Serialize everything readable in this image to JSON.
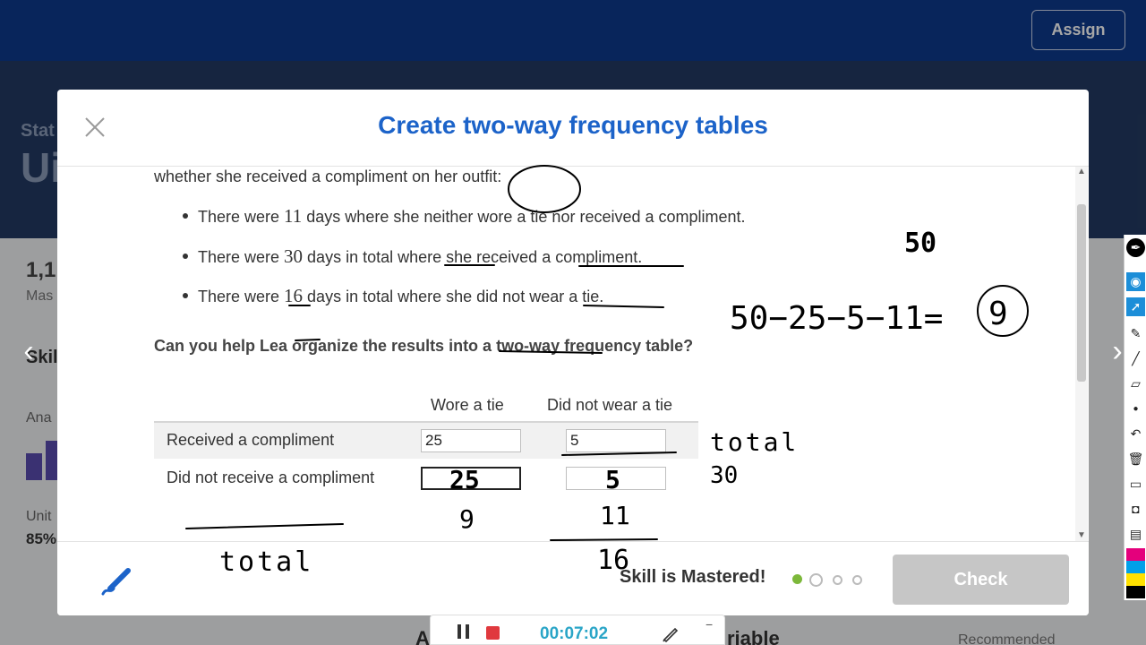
{
  "header": {
    "assign_label": "Assign"
  },
  "background": {
    "hero_sub": "Stat",
    "hero_title": "Ui",
    "stat_value": "1,1",
    "stat_label": "Mas",
    "skill_label": "Skil",
    "ana_label": "Ana",
    "unit_label": "Unit",
    "unit_pct": "85%",
    "bottom_a": "A",
    "bottom_variable": "riable",
    "recommended": "Recommended"
  },
  "modal": {
    "title": "Create two-way frequency tables",
    "intro_fragment": "whether she received a compliment on her outfit:",
    "bullets": [
      {
        "pre": "There were ",
        "num": "11",
        "post": " days where she neither wore a tie nor received a compliment."
      },
      {
        "pre": "There were ",
        "num": "30",
        "post": " days in total where she received a compliment."
      },
      {
        "pre": "There were ",
        "num": "16",
        "post": " days in total where she did not wear a tie."
      }
    ],
    "question": "Can you help Lea organize the results into a two-way frequency table?",
    "table": {
      "columns": [
        "Wore a tie",
        "Did not wear a tie"
      ],
      "rows": [
        {
          "label": "Received a compliment",
          "values": [
            "25",
            "5"
          ]
        },
        {
          "label": "Did not receive a compliment",
          "values": [
            "",
            ""
          ]
        }
      ]
    },
    "footer": {
      "status": "Skill is Mastered!",
      "check_label": "Check"
    }
  },
  "recorder": {
    "time": "00:07:02",
    "minimize": "−"
  },
  "handwriting": {
    "total_right": "total",
    "thirty": "30",
    "fifty": "50",
    "equation": "50−25−5−11=",
    "answer": "9",
    "cell1": "25",
    "cell2": "5",
    "below1": "9",
    "below2": "11",
    "sixteen": "16",
    "total_left": "total"
  },
  "colors": {
    "brand": "#0d3a8c",
    "title": "#1c63c9",
    "timer": "#2aa5c7",
    "dot_active": "#7cb83a"
  }
}
